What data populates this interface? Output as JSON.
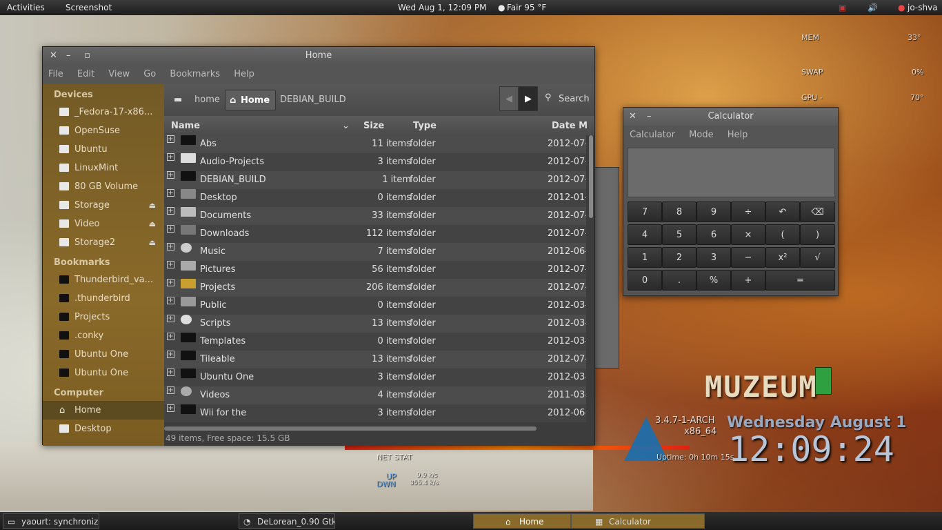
{
  "topbar": {
    "activities": "Activities",
    "app": "Screenshot",
    "datetime": "Wed Aug  1, 12:09 PM",
    "weather": "Fair 95 °F",
    "user": "jo-shva"
  },
  "nautilus": {
    "title": "Home",
    "menu": [
      "File",
      "Edit",
      "View",
      "Go",
      "Bookmarks",
      "Help"
    ],
    "sidebar": {
      "devices_heading": "Devices",
      "devices": [
        "_Fedora-17-x86...",
        "OpenSuse",
        "Ubuntu",
        "LinuxMint",
        "80 GB Volume",
        "Storage",
        "Video",
        "Storage2"
      ],
      "bookmarks_heading": "Bookmarks",
      "bookmarks": [
        "Thunderbird_va...",
        ".thunderbird",
        "Projects",
        ".conky",
        "Ubuntu One",
        "Ubuntu One"
      ],
      "computer_heading": "Computer",
      "computer": [
        "Home",
        "Desktop"
      ]
    },
    "path": {
      "home": "home",
      "current": "Home",
      "next": "DEBIAN_BUILD",
      "search": "Search"
    },
    "columns": {
      "name": "Name",
      "size": "Size",
      "type": "Type",
      "date": "Date M"
    },
    "rows": [
      {
        "name": "Abs",
        "size": "11 items",
        "type": "folder",
        "date": "2012-07-"
      },
      {
        "name": "Audio-Projects",
        "size": "3 items",
        "type": "folder",
        "date": "2012-07-"
      },
      {
        "name": "DEBIAN_BUILD",
        "size": "1 item",
        "type": "folder",
        "date": "2012-07-"
      },
      {
        "name": "Desktop",
        "size": "0 items",
        "type": "folder",
        "date": "2012-01-"
      },
      {
        "name": "Documents",
        "size": "33 items",
        "type": "folder",
        "date": "2012-07-"
      },
      {
        "name": "Downloads",
        "size": "112 items",
        "type": "folder",
        "date": "2012-07-"
      },
      {
        "name": "Music",
        "size": "7 items",
        "type": "folder",
        "date": "2012-06-"
      },
      {
        "name": "Pictures",
        "size": "56 items",
        "type": "folder",
        "date": "2012-07-"
      },
      {
        "name": "Projects",
        "size": "206 items",
        "type": "folder",
        "date": "2012-07-"
      },
      {
        "name": "Public",
        "size": "0 items",
        "type": "folder",
        "date": "2012-03-"
      },
      {
        "name": "Scripts",
        "size": "13 items",
        "type": "folder",
        "date": "2012-03-"
      },
      {
        "name": "Templates",
        "size": "0 items",
        "type": "folder",
        "date": "2012-03-"
      },
      {
        "name": "Tileable",
        "size": "13 items",
        "type": "folder",
        "date": "2012-07-"
      },
      {
        "name": "Ubuntu One",
        "size": "3 items",
        "type": "folder",
        "date": "2012-03-"
      },
      {
        "name": "Videos",
        "size": "4 items",
        "type": "folder",
        "date": "2011-03-"
      },
      {
        "name": "Wii for the",
        "size": "3 items",
        "type": "folder",
        "date": "2012-06-"
      }
    ],
    "status": "49 items, Free space: 15.5 GB"
  },
  "calculator": {
    "title": "Calculator",
    "menu": [
      "Calculator",
      "Mode",
      "Help"
    ],
    "keys": [
      "7",
      "8",
      "9",
      "÷",
      "↶",
      "⌫",
      "4",
      "5",
      "6",
      "×",
      "(",
      ")",
      "1",
      "2",
      "3",
      "−",
      "x²",
      "√",
      "0",
      ".",
      "%",
      "+",
      "="
    ]
  },
  "conky": {
    "mem": "MEM",
    "mem_val": "33°",
    "swap": "SWAP",
    "swap_val": "0%",
    "gpu": "GPU -",
    "gpu_val": "70°",
    "kernel": "3.4.7-1-ARCH",
    "arch": "x86_64",
    "uptime": "Uptime: 0h 10m 15s",
    "big_date": "Wednesday August 1",
    "big_time": "12:09:24",
    "netstat": "NET STAT",
    "up": "UP",
    "up_val": "9.9 k/s",
    "down": "DWN",
    "down_val": "355.4 k/s"
  },
  "taskbar": [
    {
      "label": "yaourt: synchronizin..."
    },
    {
      "label": "DeLorean_0.90 Gtk ..."
    },
    {
      "label": "Home"
    },
    {
      "label": "Calculator"
    }
  ]
}
